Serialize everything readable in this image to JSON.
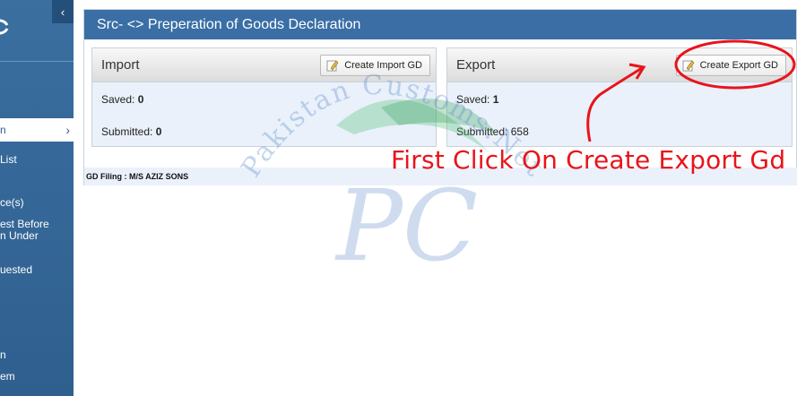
{
  "sidebar": {
    "collapse_glyph": "‹",
    "items": [
      {
        "label": "n",
        "active": true
      },
      {
        "label": "List"
      },
      {
        "label": "ce(s)"
      },
      {
        "label": "est Before"
      },
      {
        "label": "n Under"
      },
      {
        "label": "uested"
      },
      {
        "label": "n"
      },
      {
        "label": "em"
      }
    ]
  },
  "panel": {
    "title": "Src- <> Preperation of Goods Declaration"
  },
  "import_card": {
    "title": "Import",
    "button_label": "Create Import GD",
    "saved_label": "Saved:",
    "saved_value": "0",
    "submitted_label": "Submitted:",
    "submitted_value": "0"
  },
  "export_card": {
    "title": "Export",
    "button_label": "Create Export GD",
    "saved_label": "Saved:",
    "saved_value": "1",
    "submitted_label": "Submitted:",
    "submitted_value": "658"
  },
  "filing": {
    "text": "GD Filing : M/S AZIZ SONS"
  },
  "watermark": {
    "text": "Pakistan Customs.Net",
    "letters": "PC"
  },
  "annotation": {
    "text": "First Click On Create Export Gd",
    "color": "#e8141b"
  },
  "colors": {
    "sidebar": "#2f5f8f",
    "header": "#3a6ea5",
    "card_body": "#eaf1fb"
  }
}
